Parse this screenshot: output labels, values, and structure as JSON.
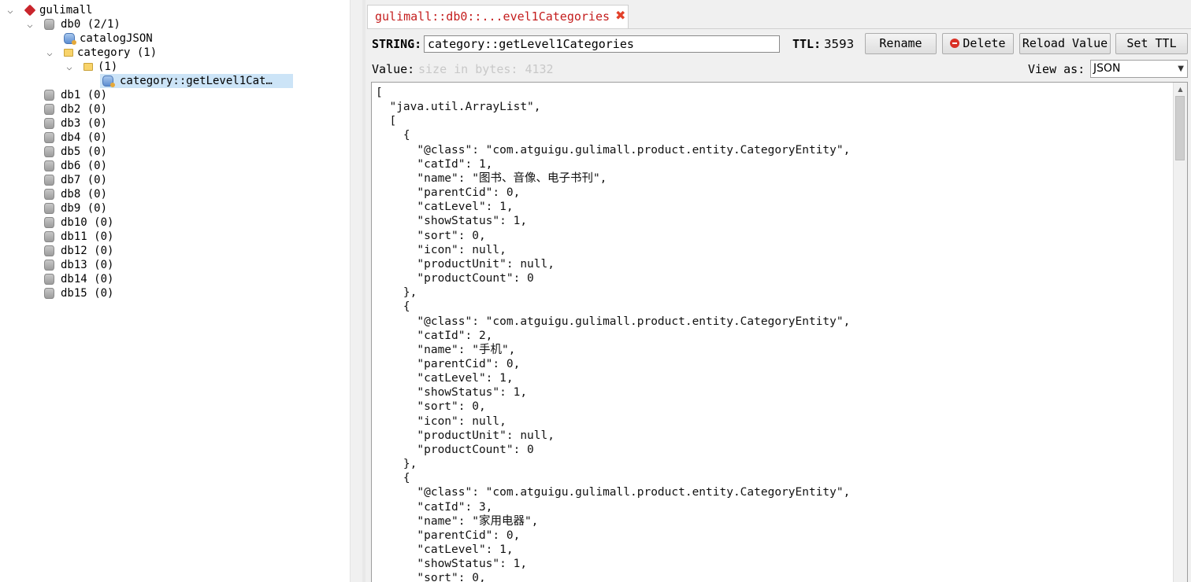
{
  "tree": {
    "server": {
      "label": "gulimall"
    },
    "db0": {
      "label": "db0  (2/1)"
    },
    "db0_children": [
      {
        "label": "catalogJSON"
      },
      {
        "label": "category (1)"
      },
      {
        "label": " (1)"
      },
      {
        "label": "category::getLevel1Cat…"
      }
    ],
    "other_dbs": [
      "db1 (0)",
      "db2 (0)",
      "db3 (0)",
      "db4 (0)",
      "db5 (0)",
      "db6 (0)",
      "db7 (0)",
      "db8 (0)",
      "db9 (0)",
      "db10 (0)",
      "db11 (0)",
      "db12 (0)",
      "db13 (0)",
      "db14 (0)",
      "db15 (0)"
    ]
  },
  "tab": {
    "title": "gulimall::db0::...evel1Categories",
    "close": "✖"
  },
  "key": {
    "type_label": "STRING:",
    "name": "category::getLevel1Categories",
    "ttl_label": "TTL:",
    "ttl_value": "3593"
  },
  "buttons": {
    "rename": "Rename",
    "delete": "Delete",
    "reload": "Reload Value",
    "set_ttl": "Set TTL"
  },
  "value": {
    "label": "Value:",
    "size_text": "size in bytes: 4132",
    "view_as_label": "View as:",
    "view_as_selected": "JSON",
    "content": "[\n  \"java.util.ArrayList\",\n  [\n    {\n      \"@class\": \"com.atguigu.gulimall.product.entity.CategoryEntity\",\n      \"catId\": 1,\n      \"name\": \"图书、音像、电子书刊\",\n      \"parentCid\": 0,\n      \"catLevel\": 1,\n      \"showStatus\": 1,\n      \"sort\": 0,\n      \"icon\": null,\n      \"productUnit\": null,\n      \"productCount\": 0\n    },\n    {\n      \"@class\": \"com.atguigu.gulimall.product.entity.CategoryEntity\",\n      \"catId\": 2,\n      \"name\": \"手机\",\n      \"parentCid\": 0,\n      \"catLevel\": 1,\n      \"showStatus\": 1,\n      \"sort\": 0,\n      \"icon\": null,\n      \"productUnit\": null,\n      \"productCount\": 0\n    },\n    {\n      \"@class\": \"com.atguigu.gulimall.product.entity.CategoryEntity\",\n      \"catId\": 3,\n      \"name\": \"家用电器\",\n      \"parentCid\": 0,\n      \"catLevel\": 1,\n      \"showStatus\": 1,\n      \"sort\": 0,"
  },
  "icons": {
    "server": "redis-server-icon",
    "database": "database-icon",
    "folder": "folder-icon",
    "key": "string-key-icon",
    "expand": "chevron-down-icon"
  }
}
